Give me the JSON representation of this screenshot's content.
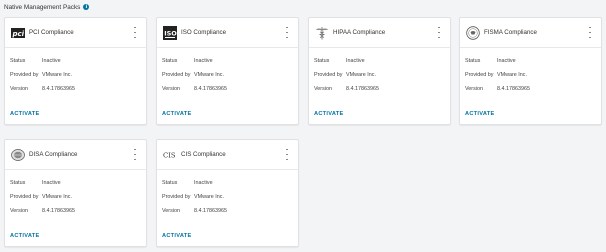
{
  "header": {
    "title": "Native Management Packs",
    "info_icon": "info-icon"
  },
  "labels": {
    "status": "Status",
    "provided_by": "Provided by",
    "version": "Version"
  },
  "cards": [
    {
      "title": "PCI Compliance",
      "logo": "pci-logo-icon",
      "status": "Inactive",
      "provided_by": "VMware Inc.",
      "version": "8.4.17863965",
      "action": "ACTIVATE"
    },
    {
      "title": "ISO Compliance",
      "logo": "iso-logo-icon",
      "status": "Inactive",
      "provided_by": "VMware Inc.",
      "version": "8.4.17863965",
      "action": "ACTIVATE"
    },
    {
      "title": "HIPAA Compliance",
      "logo": "hipaa-caduceus-icon",
      "status": "Inactive",
      "provided_by": "VMware Inc.",
      "version": "8.4.17863965",
      "action": "ACTIVATE"
    },
    {
      "title": "FISMA Compliance",
      "logo": "fisma-seal-icon",
      "status": "Inactive",
      "provided_by": "VMware Inc.",
      "version": "8.4.17863965",
      "action": "ACTIVATE"
    },
    {
      "title": "DISA Compliance",
      "logo": "disa-seal-icon",
      "status": "Inactive",
      "provided_by": "VMware Inc.",
      "version": "8.4.17863965",
      "action": "ACTIVATE"
    },
    {
      "title": "CIS Compliance",
      "logo": "cis-logo-icon",
      "status": "Inactive",
      "provided_by": "VMware Inc.",
      "version": "8.4.17863965",
      "action": "ACTIVATE"
    }
  ],
  "colors": {
    "accent": "#0072a3",
    "background": "#f3f4f5",
    "card": "#ffffff"
  }
}
